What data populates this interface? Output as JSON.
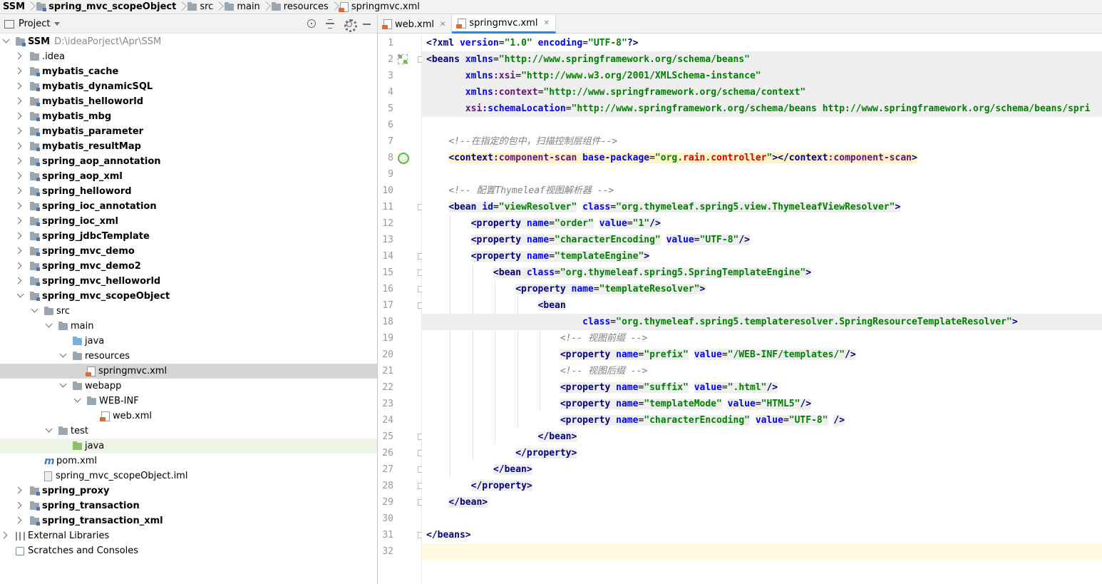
{
  "breadcrumbs": [
    "SSM",
    "spring_mvc_scopeObject",
    "src",
    "main",
    "resources",
    "springmvc.xml"
  ],
  "project_panel": {
    "title": "Project",
    "root_name": "SSM",
    "root_path": "D:\\ideaPorject\\Apr\\SSM",
    "tree": [
      {
        "label": ".idea",
        "depth": 1,
        "arrow": "r",
        "icon": "folder",
        "bold": false
      },
      {
        "label": "mybatis_cache",
        "depth": 1,
        "arrow": "r",
        "icon": "module",
        "bold": true
      },
      {
        "label": "mybatis_dynamicSQL",
        "depth": 1,
        "arrow": "r",
        "icon": "module",
        "bold": true
      },
      {
        "label": "mybatis_helloworld",
        "depth": 1,
        "arrow": "r",
        "icon": "module",
        "bold": true
      },
      {
        "label": "mybatis_mbg",
        "depth": 1,
        "arrow": "r",
        "icon": "module",
        "bold": true
      },
      {
        "label": "mybatis_parameter",
        "depth": 1,
        "arrow": "r",
        "icon": "module",
        "bold": true
      },
      {
        "label": "mybatis_resultMap",
        "depth": 1,
        "arrow": "r",
        "icon": "module",
        "bold": true
      },
      {
        "label": "spring_aop_annotation",
        "depth": 1,
        "arrow": "r",
        "icon": "module",
        "bold": true
      },
      {
        "label": "spring_aop_xml",
        "depth": 1,
        "arrow": "r",
        "icon": "module",
        "bold": true
      },
      {
        "label": "spring_helloword",
        "depth": 1,
        "arrow": "r",
        "icon": "module",
        "bold": true
      },
      {
        "label": "spring_ioc_annotation",
        "depth": 1,
        "arrow": "r",
        "icon": "module",
        "bold": true
      },
      {
        "label": "spring_ioc_xml",
        "depth": 1,
        "arrow": "r",
        "icon": "module",
        "bold": true
      },
      {
        "label": "spring_jdbcTemplate",
        "depth": 1,
        "arrow": "r",
        "icon": "module",
        "bold": true
      },
      {
        "label": "spring_mvc_demo",
        "depth": 1,
        "arrow": "r",
        "icon": "module",
        "bold": true
      },
      {
        "label": "spring_mvc_demo2",
        "depth": 1,
        "arrow": "r",
        "icon": "module",
        "bold": true
      },
      {
        "label": "spring_mvc_helloworld",
        "depth": 1,
        "arrow": "r",
        "icon": "module",
        "bold": true
      },
      {
        "label": "spring_mvc_scopeObject",
        "depth": 1,
        "arrow": "d",
        "icon": "module",
        "bold": true
      },
      {
        "label": "src",
        "depth": 2,
        "arrow": "d",
        "icon": "folder",
        "bold": false
      },
      {
        "label": "main",
        "depth": 3,
        "arrow": "d",
        "icon": "folder",
        "bold": false
      },
      {
        "label": "java",
        "depth": 4,
        "arrow": "",
        "icon": "blue",
        "bold": false
      },
      {
        "label": "resources",
        "depth": 4,
        "arrow": "d",
        "icon": "folder",
        "bold": false
      },
      {
        "label": "springmvc.xml",
        "depth": 5,
        "arrow": "",
        "icon": "xml",
        "bold": false,
        "state": "selected"
      },
      {
        "label": "webapp",
        "depth": 4,
        "arrow": "d",
        "icon": "folder",
        "bold": false
      },
      {
        "label": "WEB-INF",
        "depth": 5,
        "arrow": "d",
        "icon": "folder",
        "bold": false
      },
      {
        "label": "web.xml",
        "depth": 6,
        "arrow": "",
        "icon": "xml",
        "bold": false
      },
      {
        "label": "test",
        "depth": 3,
        "arrow": "d",
        "icon": "folder",
        "bold": false
      },
      {
        "label": "java",
        "depth": 4,
        "arrow": "",
        "icon": "green",
        "bold": false,
        "state": "highlight"
      },
      {
        "label": "pom.xml",
        "depth": 2,
        "arrow": "",
        "icon": "maven",
        "bold": false
      },
      {
        "label": "spring_mvc_scopeObject.iml",
        "depth": 2,
        "arrow": "",
        "icon": "iml",
        "bold": false
      },
      {
        "label": "spring_proxy",
        "depth": 1,
        "arrow": "r",
        "icon": "module",
        "bold": true
      },
      {
        "label": "spring_transaction",
        "depth": 1,
        "arrow": "r",
        "icon": "module",
        "bold": true
      },
      {
        "label": "spring_transaction_xml",
        "depth": 1,
        "arrow": "r",
        "icon": "module",
        "bold": true
      },
      {
        "label": "External Libraries",
        "depth": 0,
        "arrow": "r",
        "icon": "lib",
        "bold": false
      },
      {
        "label": "Scratches and Consoles",
        "depth": 0,
        "arrow": "",
        "icon": "scratch",
        "bold": false
      }
    ]
  },
  "tabs": [
    {
      "label": "web.xml",
      "active": false
    },
    {
      "label": "springmvc.xml",
      "active": true
    }
  ],
  "code_lines": [
    [
      [
        "t",
        "<?"
      ],
      [
        "t",
        "xml "
      ],
      [
        "a",
        "version"
      ],
      [
        "p",
        "="
      ],
      [
        "v",
        "\"1.0\""
      ],
      [
        "p",
        " "
      ],
      [
        "a",
        "encoding"
      ],
      [
        "p",
        "="
      ],
      [
        "v",
        "\"UTF-8\""
      ],
      [
        "t",
        "?>"
      ]
    ],
    [
      [
        "t",
        "<beans "
      ],
      [
        "a",
        "xmlns"
      ],
      [
        "p",
        "="
      ],
      [
        "v",
        "\"http://www.springframework.org/schema/beans\""
      ]
    ],
    [
      [
        "p",
        "       "
      ],
      [
        "a",
        "xmlns"
      ],
      [
        "an",
        ":xsi"
      ],
      [
        "p",
        "="
      ],
      [
        "v",
        "\"http://www.w3.org/2001/XMLSchema-instance\""
      ]
    ],
    [
      [
        "p",
        "       "
      ],
      [
        "a",
        "xmlns"
      ],
      [
        "an",
        ":context"
      ],
      [
        "p",
        "="
      ],
      [
        "v",
        "\"http://www.springframework.org/schema/context\""
      ]
    ],
    [
      [
        "p",
        "       "
      ],
      [
        "an",
        "xsi"
      ],
      [
        "a",
        ":schemaLocation"
      ],
      [
        "p",
        "="
      ],
      [
        "v",
        "\"http://www.springframework.org/schema/beans http://www.springframework.org/schema/beans/spri"
      ]
    ],
    [],
    [
      [
        "p",
        "    "
      ],
      [
        "c",
        "<!--在指定的包中，扫描控制层组件-->"
      ]
    ],
    [
      [
        "p",
        "    "
      ],
      [
        "t",
        "<context"
      ],
      [
        "an",
        ":component-scan "
      ],
      [
        "a",
        "base-package"
      ],
      [
        "p",
        "="
      ],
      [
        "v",
        "\"org."
      ],
      [
        "vh",
        "rain"
      ],
      [
        "v",
        "."
      ],
      [
        "vh",
        "controller"
      ],
      [
        "v",
        "\""
      ],
      [
        "t",
        "></context"
      ],
      [
        "an",
        ":component-scan"
      ],
      [
        "t",
        ">"
      ]
    ],
    [],
    [
      [
        "p",
        "    "
      ],
      [
        "c",
        "<!-- 配置Thymeleaf视图解析器 -->"
      ]
    ],
    [
      [
        "p",
        "    "
      ],
      [
        "t",
        "<bean "
      ],
      [
        "a",
        "id"
      ],
      [
        "p",
        "="
      ],
      [
        "v",
        "\"viewResolver\""
      ],
      [
        "p",
        " "
      ],
      [
        "a",
        "class"
      ],
      [
        "p",
        "="
      ],
      [
        "v",
        "\"org.thymeleaf.spring5.view.ThymeleafViewResolver\""
      ],
      [
        "t",
        ">"
      ]
    ],
    [
      [
        "p",
        "        "
      ],
      [
        "t",
        "<property "
      ],
      [
        "a",
        "name"
      ],
      [
        "p",
        "="
      ],
      [
        "v",
        "\"order\""
      ],
      [
        "p",
        " "
      ],
      [
        "a",
        "value"
      ],
      [
        "p",
        "="
      ],
      [
        "v",
        "\"1\""
      ],
      [
        "t",
        "/>"
      ]
    ],
    [
      [
        "p",
        "        "
      ],
      [
        "t",
        "<property "
      ],
      [
        "a",
        "name"
      ],
      [
        "p",
        "="
      ],
      [
        "v",
        "\"characterEncoding\""
      ],
      [
        "p",
        " "
      ],
      [
        "a",
        "value"
      ],
      [
        "p",
        "="
      ],
      [
        "v",
        "\"UTF-8\""
      ],
      [
        "t",
        "/>"
      ]
    ],
    [
      [
        "p",
        "        "
      ],
      [
        "t",
        "<property "
      ],
      [
        "a",
        "name"
      ],
      [
        "p",
        "="
      ],
      [
        "v",
        "\"templateEngine\""
      ],
      [
        "t",
        ">"
      ]
    ],
    [
      [
        "p",
        "            "
      ],
      [
        "t",
        "<bean "
      ],
      [
        "a",
        "class"
      ],
      [
        "p",
        "="
      ],
      [
        "v",
        "\"org.thymeleaf.spring5.SpringTemplateEngine\""
      ],
      [
        "t",
        ">"
      ]
    ],
    [
      [
        "p",
        "                "
      ],
      [
        "t",
        "<property "
      ],
      [
        "a",
        "name"
      ],
      [
        "p",
        "="
      ],
      [
        "v",
        "\"templateResolver\""
      ],
      [
        "t",
        ">"
      ]
    ],
    [
      [
        "p",
        "                    "
      ],
      [
        "t",
        "<bean"
      ]
    ],
    [
      [
        "p",
        "                            "
      ],
      [
        "a",
        "class"
      ],
      [
        "p",
        "="
      ],
      [
        "v",
        "\"org.thymeleaf.spring5.templateresolver.SpringResourceTemplateResolver\""
      ],
      [
        "t",
        ">"
      ]
    ],
    [
      [
        "p",
        "                        "
      ],
      [
        "c",
        "<!-- 视图前缀 -->"
      ]
    ],
    [
      [
        "p",
        "                        "
      ],
      [
        "t",
        "<property "
      ],
      [
        "a",
        "name"
      ],
      [
        "p",
        "="
      ],
      [
        "v",
        "\"prefix\""
      ],
      [
        "p",
        " "
      ],
      [
        "a",
        "value"
      ],
      [
        "p",
        "="
      ],
      [
        "v",
        "\"/WEB-INF/templates/\""
      ],
      [
        "t",
        "/>"
      ]
    ],
    [
      [
        "p",
        "                        "
      ],
      [
        "c",
        "<!-- 视图后缀 -->"
      ]
    ],
    [
      [
        "p",
        "                        "
      ],
      [
        "t",
        "<property "
      ],
      [
        "a",
        "name"
      ],
      [
        "p",
        "="
      ],
      [
        "v",
        "\"suffix\""
      ],
      [
        "p",
        " "
      ],
      [
        "a",
        "value"
      ],
      [
        "p",
        "="
      ],
      [
        "v",
        "\".html\""
      ],
      [
        "t",
        "/>"
      ]
    ],
    [
      [
        "p",
        "                        "
      ],
      [
        "t",
        "<property "
      ],
      [
        "a",
        "name"
      ],
      [
        "p",
        "="
      ],
      [
        "v",
        "\"templateMode\""
      ],
      [
        "p",
        " "
      ],
      [
        "a",
        "value"
      ],
      [
        "p",
        "="
      ],
      [
        "v",
        "\"HTML5\""
      ],
      [
        "t",
        "/>"
      ]
    ],
    [
      [
        "p",
        "                        "
      ],
      [
        "t",
        "<property "
      ],
      [
        "a",
        "name"
      ],
      [
        "p",
        "="
      ],
      [
        "v",
        "\"characterEncoding\""
      ],
      [
        "p",
        " "
      ],
      [
        "a",
        "value"
      ],
      [
        "p",
        "="
      ],
      [
        "v",
        "\"UTF-8\""
      ],
      [
        "p",
        " "
      ],
      [
        "t",
        "/>"
      ]
    ],
    [
      [
        "p",
        "                    "
      ],
      [
        "t",
        "</bean>"
      ]
    ],
    [
      [
        "p",
        "                "
      ],
      [
        "t",
        "</property>"
      ]
    ],
    [
      [
        "p",
        "            "
      ],
      [
        "t",
        "</bean>"
      ]
    ],
    [
      [
        "p",
        "        "
      ],
      [
        "t",
        "</property>"
      ]
    ],
    [
      [
        "p",
        "    "
      ],
      [
        "t",
        "</bean>"
      ]
    ],
    [],
    [
      [
        "t",
        "</beans>"
      ]
    ],
    []
  ],
  "colors": {
    "tag": "#000080",
    "attr": "#0000ff",
    "namespace": "#660e7a",
    "value": "#008000",
    "comment": "#808080",
    "current_line": "#fffae3",
    "selection_row": "#d5d5d5",
    "tab_underline": "#4083c9"
  }
}
